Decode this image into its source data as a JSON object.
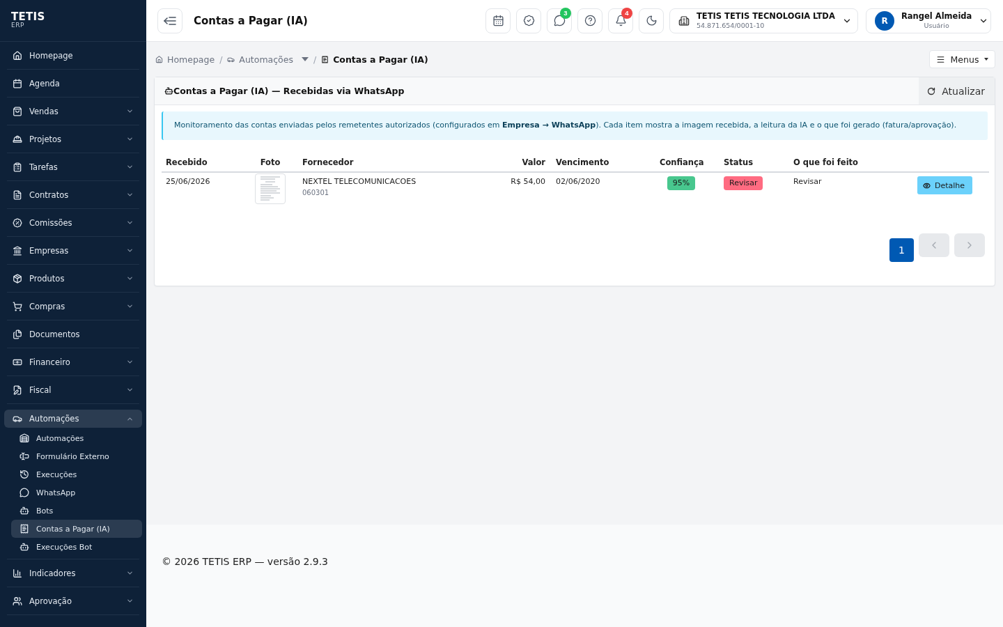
{
  "sidebar": {
    "logo": {
      "title": "TETIS",
      "subtitle": "ERP"
    },
    "items": [
      {
        "label": "Homepage",
        "kind": "link",
        "expanded": false
      },
      {
        "label": "Agenda",
        "kind": "link",
        "expanded": false
      },
      {
        "label": "Vendas",
        "kind": "group",
        "expanded": false
      },
      {
        "label": "Projetos",
        "kind": "group",
        "expanded": false
      },
      {
        "label": "Tarefas",
        "kind": "group",
        "expanded": false
      },
      {
        "label": "Contratos",
        "kind": "group",
        "expanded": false
      },
      {
        "label": "Comissões",
        "kind": "group",
        "expanded": false
      },
      {
        "label": "Empresas",
        "kind": "group",
        "expanded": false
      },
      {
        "label": "Produtos",
        "kind": "group",
        "expanded": false
      },
      {
        "label": "Compras",
        "kind": "group",
        "expanded": false
      },
      {
        "label": "Documentos",
        "kind": "link",
        "expanded": false
      },
      {
        "label": "Financeiro",
        "kind": "group",
        "expanded": false
      },
      {
        "label": "Fiscal",
        "kind": "group",
        "expanded": false
      },
      {
        "label": "Automações",
        "kind": "group",
        "expanded": true,
        "children": [
          {
            "label": "Automações",
            "selected": false
          },
          {
            "label": "Formulário Externo",
            "selected": false
          },
          {
            "label": "Execuções",
            "selected": false
          },
          {
            "label": "WhatsApp",
            "selected": false
          },
          {
            "label": "Bots",
            "selected": false
          },
          {
            "label": "Contas a Pagar (IA)",
            "selected": true
          },
          {
            "label": "Execuções Bot",
            "selected": false
          }
        ]
      },
      {
        "label": "Indicadores",
        "kind": "group",
        "expanded": false
      },
      {
        "label": "Aprovação",
        "kind": "group",
        "expanded": false
      }
    ]
  },
  "header": {
    "title": "Contas a Pagar (IA)",
    "whatsapp_badge": "3",
    "notifications_badge": "4",
    "company": {
      "name": "TETIS TETIS TECNOLOGIA LTDA",
      "cnpj": "54.871.654/0001-10"
    },
    "user": {
      "initial": "R",
      "name": "Rangel Almeida",
      "role": "Usuário"
    }
  },
  "breadcrumb": [
    {
      "label": "Homepage",
      "kind": "link"
    },
    {
      "separator": "/",
      "label": "Automações",
      "kind": "dropdown"
    },
    {
      "separator": "/",
      "label": "Contas a Pagar (IA)",
      "kind": "current"
    }
  ],
  "menus_button": "Menus",
  "card": {
    "title": "Contas a Pagar (IA) — Recebidas via WhatsApp",
    "refresh_button": "Atualizar",
    "info": "Monitoramento das contas enviadas pelos remetentes autorizados (configurados em **Empresa → WhatsApp**). Cada item mostra a imagem recebida, a leitura da IA e o que foi gerado (fatura/aprovação).",
    "table": {
      "columns": [
        "Recebido",
        "Foto",
        "Fornecedor",
        "Valor",
        "Vencimento",
        "Confiança",
        "Status",
        "O que foi feito"
      ],
      "rows": [
        {
          "received": "25/06/2026",
          "supplier": "NEXTEL TELECOMUNICACOES",
          "supplier_code": "060301",
          "amount": "R$ 54,00",
          "due_date": "02/06/2020",
          "confidence": "95%",
          "status": {
            "label": "Revisar",
            "kind": "review"
          },
          "action_taken": "Revisar",
          "detail_button": "Detalhe"
        }
      ]
    },
    "pagination": {
      "pages": [
        {
          "label": "1",
          "selected": true
        }
      ],
      "prev": {
        "disabled": true
      },
      "next": {
        "disabled": true
      }
    }
  },
  "footer": "© 2026 TETIS ERP — versão 2.9.3"
}
